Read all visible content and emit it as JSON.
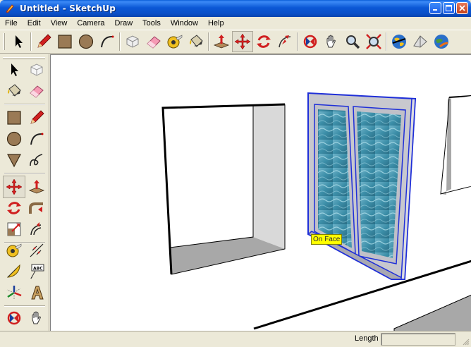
{
  "window": {
    "title": "Untitled - SketchUp"
  },
  "menu": [
    "File",
    "Edit",
    "View",
    "Camera",
    "Draw",
    "Tools",
    "Window",
    "Help"
  ],
  "toolbar_top": [
    "select",
    "pencil",
    "rectangle",
    "circle",
    "arc",
    "make-component",
    "eraser",
    "tape-measure",
    "paint-bucket",
    "push-pull",
    "move",
    "rotate",
    "follow-me",
    "orbit",
    "pan",
    "zoom",
    "zoom-extents",
    "get-models",
    "share-model",
    "google-earth"
  ],
  "toolbar_left": [
    "select",
    "make-component",
    "paint-bucket",
    "eraser",
    "rectangle",
    "line",
    "circle",
    "arc",
    "polygon",
    "freehand",
    "move",
    "push-pull",
    "rotate",
    "follow-me",
    "scale",
    "offset",
    "tape-measure",
    "dimension",
    "protractor",
    "text",
    "axes",
    "3d-text",
    "orbit",
    "pan"
  ],
  "viewport": {
    "tooltip": "On Face"
  },
  "statusbar": {
    "measurement_label": "Length",
    "measurement_value": ""
  }
}
